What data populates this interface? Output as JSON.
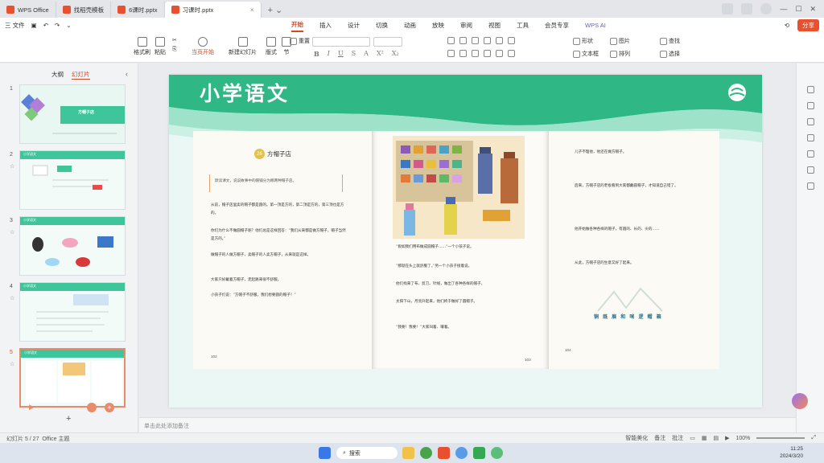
{
  "tabs": [
    {
      "label": "WPS Office",
      "color": "#e8502e"
    },
    {
      "label": "找稻壳模板",
      "color": "#e8502e"
    },
    {
      "label": "6课时.pptx",
      "color": "#e8502e"
    },
    {
      "label": "习课时.pptx",
      "color": "#e8502e"
    }
  ],
  "menubar": {
    "file": "三 文件",
    "tabs": [
      "开始",
      "插入",
      "设计",
      "切换",
      "动画",
      "放映",
      "审阅",
      "视图",
      "工具",
      "会员专享"
    ],
    "wps_ai": "WPS AI",
    "share": "分享"
  },
  "ribbon": {
    "format_painter": "格式刷",
    "paste": "粘贴",
    "play_from_current": "当页开始",
    "new_slide": "新建幻灯片",
    "layout": "版式",
    "section": "节",
    "reset": "重置",
    "shape": "形状",
    "picture": "图片",
    "textbox": "文本框",
    "arrange": "排列",
    "find": "查找",
    "select": "选择",
    "font_format_buttons": [
      "B",
      "I",
      "U",
      "S",
      "A",
      "X²",
      "X₂"
    ]
  },
  "left_panel": {
    "tabs": [
      "大纲",
      "幻灯片"
    ],
    "thumbs": [
      {
        "num": "1",
        "title": "方帽子店"
      },
      {
        "num": "2",
        "title": "小学语文"
      },
      {
        "num": "3",
        "title": "小学语文"
      },
      {
        "num": "4",
        "title": "小学语文"
      },
      {
        "num": "5",
        "title": "小学语文"
      }
    ]
  },
  "slide": {
    "title": "小学语文",
    "lesson_number": "26",
    "lesson_title": "方帽子店",
    "intro": "默读课文，说说故事中的帽铺分为哪两种帽子店。",
    "page_numbers": [
      "102",
      "103",
      "104"
    ],
    "left_page": [
      "从前，帽子店里卖的帽子都是圆的。第一顶是方的，第二顶是方的，第三顶也是方的。",
      "你们为什么不做圆帽子呢？他们总是这样回答：“我们从来都是做方帽子，帽子当然是方的。”",
      "做帽子的人做方帽子，卖帽子的人卖方帽子，从来就是这样。",
      "大家只好戴着方帽子，走起路来很不舒服。",
      "小孩子们说：“方帽子不舒服，我们想要圆的帽子！”"
    ],
    "middle_page": [
      "“假如我们用布做成圆帽子……”一个小孩子说。",
      "“那就在头上就舒服了。”另一个小孩子接着说。",
      "他们找来了布、剪刀、针线，做出了各种各样的帽子。",
      "太阳下山，月亮升起来，他们终于做好了圆帽子。",
      "“我要！我要！”大家叫着、嚷着。"
    ],
    "right_page": [
      "儿子不理他，他还在做方帽子。",
      "后来，方帽子店的老板看到大家都戴圆帽子，才知道自己错了。",
      "他开始做各种各样的帽子，有圆的、长的、尖的……",
      "从此，方帽子店的生意又好了起来。"
    ],
    "right_page_words": "铜 既 展 和 咪 逻 帽 箱"
  },
  "notes_placeholder": "单击此处添加备注",
  "status": {
    "slide_info": "幻灯片 5 / 27",
    "theme": "Office 主题",
    "smart_beautify": "智能美化",
    "notes": "备注",
    "comment": "批注",
    "zoom": "100%"
  },
  "taskbar": {
    "search": "搜索",
    "time": "11:25",
    "date": "2024/3/20"
  },
  "colors": {
    "accent": "#d04a2a",
    "slide_green": "#3fc59a"
  }
}
